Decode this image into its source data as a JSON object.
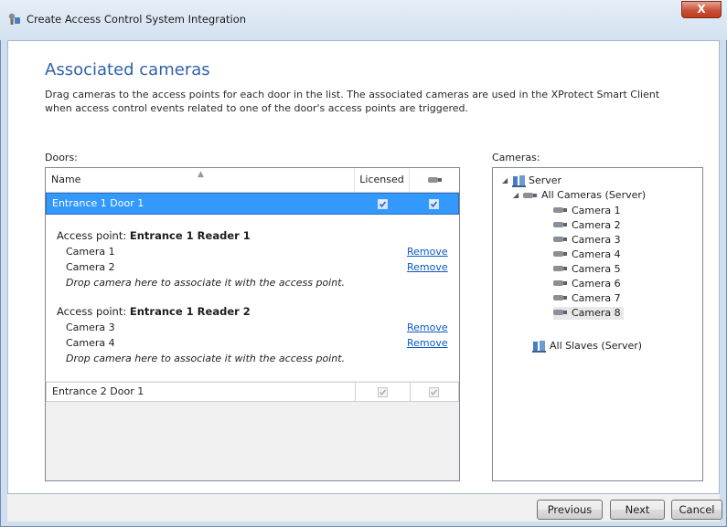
{
  "window": {
    "title": "Create Access Control System Integration",
    "close_label": "X"
  },
  "page": {
    "heading": "Associated cameras",
    "description": "Drag cameras to the access points for each door in the list. The associated cameras are used in the XProtect Smart Client when access control events related to one of the door's access points are triggered."
  },
  "doors": {
    "label": "Doors:",
    "columns": {
      "name": "Name",
      "licensed": "Licensed",
      "camera": "camera-icon"
    },
    "rows": [
      {
        "name": "Entrance 1 Door 1",
        "licensed": true,
        "camera": true,
        "selected": true,
        "access_points": [
          {
            "prefix": "Access point:",
            "name": "Entrance 1 Reader 1",
            "cameras": [
              "Camera 1",
              "Camera 2"
            ],
            "remove_label": "Remove",
            "drop_hint": "Drop camera here to associate it with the access point."
          },
          {
            "prefix": "Access point:",
            "name": "Entrance 1 Reader 2",
            "cameras": [
              "Camera 3",
              "Camera 4"
            ],
            "remove_label": "Remove",
            "drop_hint": "Drop camera here to associate it with the access point."
          }
        ]
      },
      {
        "name": "Entrance 2 Door 1",
        "licensed": true,
        "camera": true,
        "selected": false,
        "disabled": true
      }
    ]
  },
  "cameras": {
    "label": "Cameras:",
    "tree": {
      "server": "Server",
      "group": "All Cameras (Server)",
      "items": [
        "Camera 1",
        "Camera 2",
        "Camera 3",
        "Camera 4",
        "Camera 5",
        "Camera 6",
        "Camera 7",
        "Camera 8"
      ],
      "slaves": "All Slaves (Server)"
    }
  },
  "buttons": {
    "previous": "Previous",
    "next": "Next",
    "cancel": "Cancel"
  },
  "colors": {
    "accent": "#2f62a8",
    "selection": "#3399ff",
    "link": "#0a58c4"
  }
}
